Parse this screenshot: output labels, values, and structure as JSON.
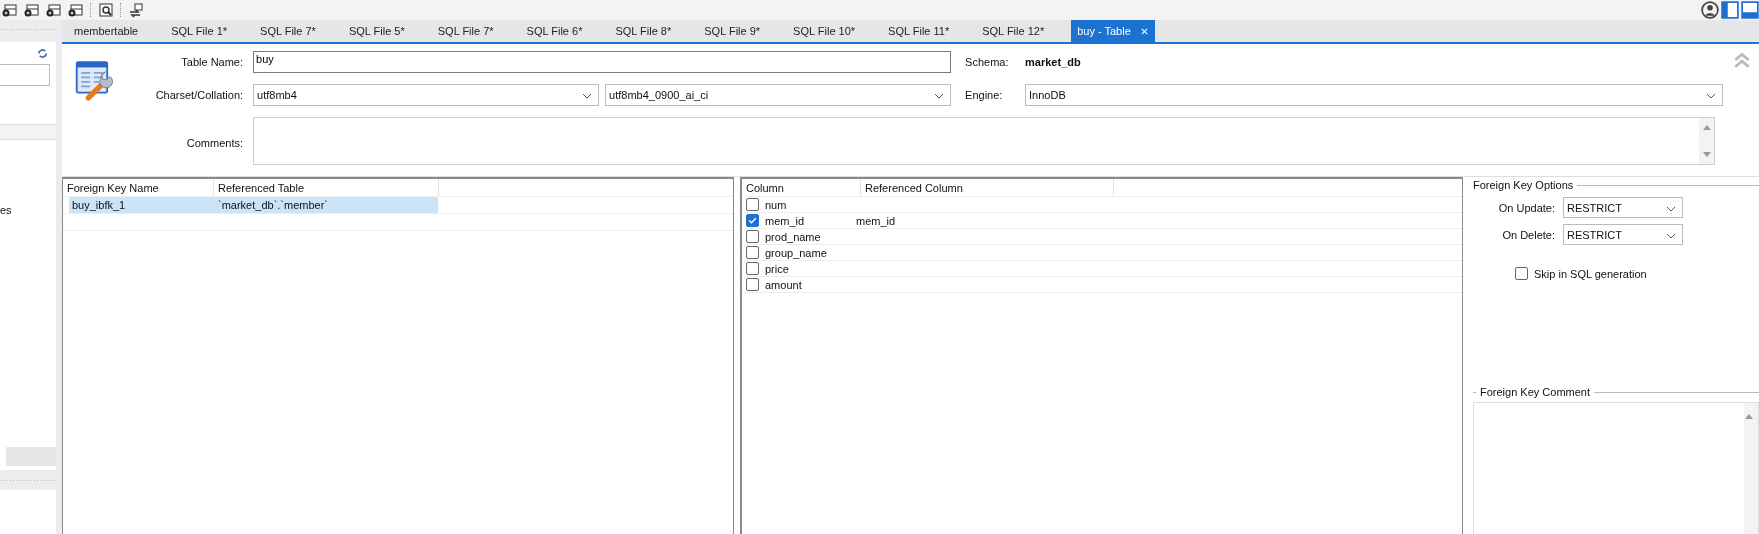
{
  "sidebar": {
    "partial_text": "es"
  },
  "tabs": [
    {
      "label": "membertable",
      "selected": false,
      "closable": false
    },
    {
      "label": "SQL File 1*",
      "selected": false,
      "closable": false
    },
    {
      "label": "SQL File 7*",
      "selected": false,
      "closable": false
    },
    {
      "label": "SQL File 5*",
      "selected": false,
      "closable": false
    },
    {
      "label": "SQL File 7*",
      "selected": false,
      "closable": false
    },
    {
      "label": "SQL File 6*",
      "selected": false,
      "closable": false
    },
    {
      "label": "SQL File 8*",
      "selected": false,
      "closable": false
    },
    {
      "label": "SQL File 9*",
      "selected": false,
      "closable": false
    },
    {
      "label": "SQL File 10*",
      "selected": false,
      "closable": false
    },
    {
      "label": "SQL File 11*",
      "selected": false,
      "closable": false
    },
    {
      "label": "SQL File 12*",
      "selected": false,
      "closable": false
    },
    {
      "label": "buy - Table",
      "selected": true,
      "closable": true
    }
  ],
  "table_form": {
    "table_name_label": "Table Name:",
    "table_name": "buy",
    "charset_label": "Charset/Collation:",
    "charset": "utf8mb4",
    "collation": "utf8mb4_0900_ai_ci",
    "schema_label": "Schema:",
    "schema": "market_db",
    "engine_label": "Engine:",
    "engine": "InnoDB",
    "comments_label": "Comments:"
  },
  "foreign_keys": {
    "columns": [
      "Foreign Key Name",
      "Referenced Table"
    ],
    "rows": [
      {
        "cells": [
          "buy_ibfk_1",
          "`market_db`.`member`"
        ],
        "selected": true
      }
    ]
  },
  "fk_columns": {
    "columns": [
      "Column",
      "Referenced Column"
    ],
    "rows": [
      {
        "name": "num",
        "checked": false,
        "referenced": ""
      },
      {
        "name": "mem_id",
        "checked": true,
        "referenced": "mem_id"
      },
      {
        "name": "prod_name",
        "checked": false,
        "referenced": ""
      },
      {
        "name": "group_name",
        "checked": false,
        "referenced": ""
      },
      {
        "name": "price",
        "checked": false,
        "referenced": ""
      },
      {
        "name": "amount",
        "checked": false,
        "referenced": ""
      }
    ]
  },
  "fk_options": {
    "title": "Foreign Key Options",
    "on_update_label": "On Update:",
    "on_update": "RESTRICT",
    "on_delete_label": "On Delete:",
    "on_delete": "RESTRICT",
    "skip_label": "Skip in SQL generation",
    "skip_checked": false,
    "comment_title": "Foreign Key Comment"
  }
}
